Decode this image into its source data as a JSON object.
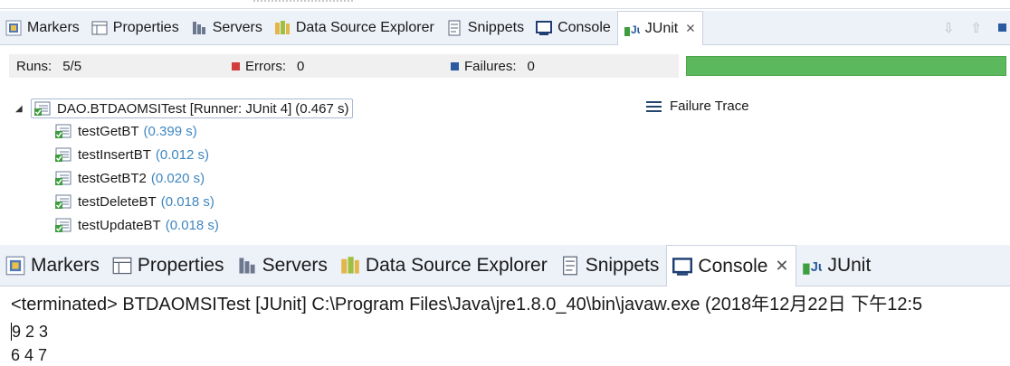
{
  "tabs_top": [
    {
      "label": "Markers",
      "icon": "markers-icon"
    },
    {
      "label": "Properties",
      "icon": "properties-icon"
    },
    {
      "label": "Servers",
      "icon": "servers-icon"
    },
    {
      "label": "Data Source Explorer",
      "icon": "data-source-icon"
    },
    {
      "label": "Snippets",
      "icon": "snippets-icon"
    },
    {
      "label": "Console",
      "icon": "console-icon"
    },
    {
      "label": "JUnit",
      "icon": "junit-icon",
      "active": true
    }
  ],
  "tabs_bottom": [
    {
      "label": "Markers",
      "icon": "markers-icon"
    },
    {
      "label": "Properties",
      "icon": "properties-icon"
    },
    {
      "label": "Servers",
      "icon": "servers-icon"
    },
    {
      "label": "Data Source Explorer",
      "icon": "data-source-icon"
    },
    {
      "label": "Snippets",
      "icon": "snippets-icon"
    },
    {
      "label": "Console",
      "icon": "console-icon",
      "active": true
    },
    {
      "label": "JUnit",
      "icon": "junit-icon"
    }
  ],
  "junit": {
    "runs_label": "Runs:",
    "runs_value": "5/5",
    "errors_label": "Errors:",
    "errors_value": "0",
    "failures_label": "Failures:",
    "failures_value": "0",
    "progress_fraction": 1.0,
    "progress_color": "#5cb85c",
    "root": {
      "name": "DAO.BTDAOMSITest [Runner: JUnit 4]",
      "duration": "(0.467 s)"
    },
    "tests": [
      {
        "name": "testGetBT",
        "duration": "(0.399 s)"
      },
      {
        "name": "testInsertBT",
        "duration": "(0.012 s)"
      },
      {
        "name": "testGetBT2",
        "duration": "(0.020 s)"
      },
      {
        "name": "testDeleteBT",
        "duration": "(0.018 s)"
      },
      {
        "name": "testUpdateBT",
        "duration": "(0.018 s)"
      }
    ],
    "failure_trace_label": "Failure Trace"
  },
  "console": {
    "header": "<terminated> BTDAOMSITest [JUnit] C:\\Program Files\\Java\\jre1.8.0_40\\bin\\javaw.exe (2018年12月22日 下午12:5",
    "lines": [
      "9 2 3",
      "6 4 7"
    ]
  }
}
